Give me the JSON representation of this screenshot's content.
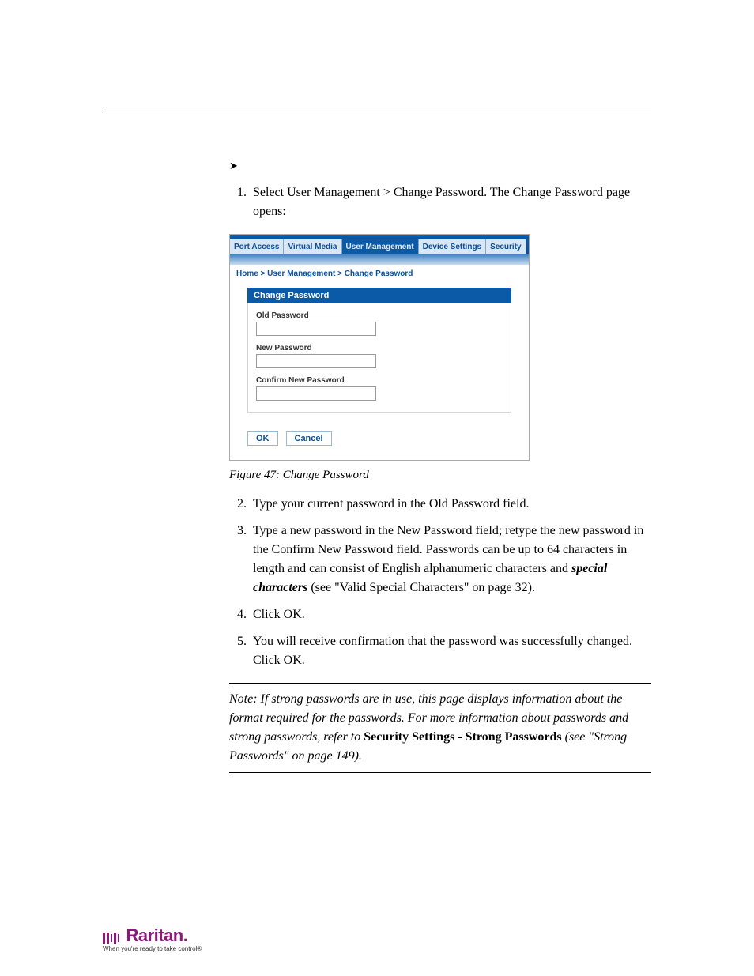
{
  "doc": {
    "chapter_title": "",
    "arrow_glyph": "➤",
    "arrow_label": "",
    "steps_a": [
      "Select User Management > Change Password. The Change Password page opens:"
    ],
    "figure_caption": "Figure 47: Change Password",
    "steps_b": [
      "Type your current password in the Old Password field.",
      "Type a new password in the New Password field; retype the new password in the Confirm New Password field. Passwords can be up to 64 characters in length and can consist of English alphanumeric characters and ",
      "Click OK.",
      "You will receive confirmation that the password was successfully changed. Click OK."
    ],
    "step3_emph": "special characters",
    "step3_tail": " (see \"Valid Special Characters\" on page 32).",
    "note_prefix": "Note: If strong passwords are in use, this page displays information about the format required for the passwords. For more information about passwords and strong passwords, refer to ",
    "note_bold": "Security Settings - Strong Passwords",
    "note_suffix": " (see \"Strong Passwords\" on page 149).",
    "page_number": ""
  },
  "ss": {
    "tabs": [
      "Port Access",
      "Virtual Media",
      "User Management",
      "Device Settings",
      "Security"
    ],
    "breadcrumb": "Home > User Management > Change Password",
    "panel_title": "Change Password",
    "fields": {
      "old": "Old Password",
      "new": "New Password",
      "confirm": "Confirm New Password"
    },
    "buttons": {
      "ok": "OK",
      "cancel": "Cancel"
    }
  },
  "footer": {
    "brand": "Raritan",
    "tagline": "When you're ready to take control®"
  }
}
